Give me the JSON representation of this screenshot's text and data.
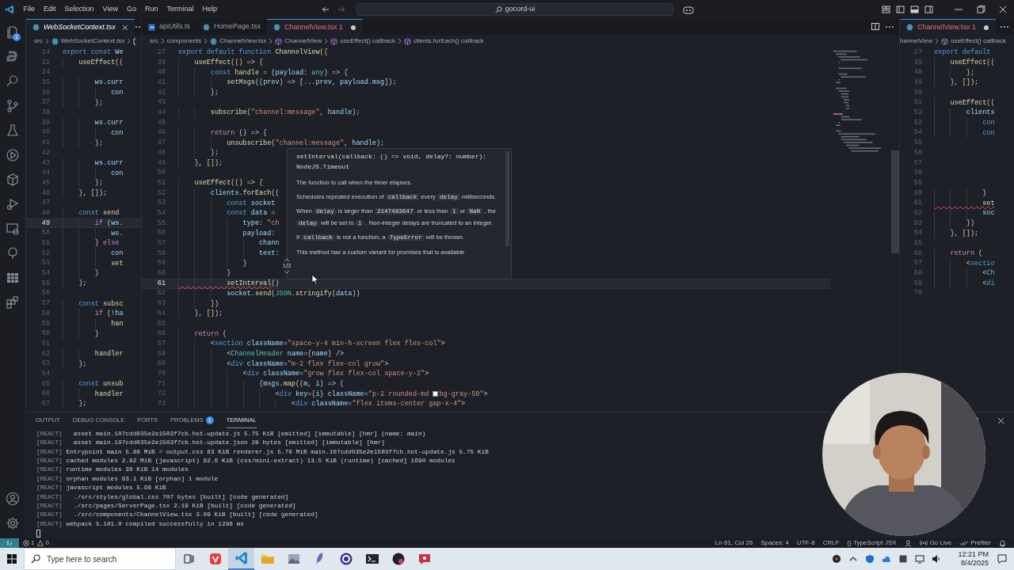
{
  "title_bar": {
    "menus": [
      "File",
      "Edit",
      "Selection",
      "View",
      "Go",
      "Run",
      "Terminal",
      "Help"
    ],
    "search": "gocord-ui"
  },
  "activity_bar": {
    "explorer_badge": "1"
  },
  "editor_groups": [
    {
      "tabs": [
        {
          "label": "WebSocketContext.tsx",
          "kind": "react",
          "selected": true,
          "preview": true,
          "dirty": false,
          "error": false
        }
      ],
      "breadcrumbs": [
        {
          "label": "src",
          "kind": "plain"
        },
        {
          "label": "WebSocketContext.tsx",
          "kind": "react"
        },
        {
          "kind": "cut"
        }
      ],
      "lines": [
        {
          "n": "14",
          "current": false,
          "t": [
            {
              "kind": "kw",
              "text": "export const "
            },
            {
              "kind": "var",
              "text": "We"
            }
          ]
        },
        {
          "n": "22",
          "current": false,
          "t": [
            {
              "kind": "fn",
              "text": "    useEffect"
            },
            {
              "kind": "br",
              "text": "(("
            }
          ]
        },
        {
          "n": "34",
          "current": false
        },
        {
          "n": "35",
          "current": false,
          "t": [
            {
              "kind": "var",
              "text": "        ws"
            },
            {
              "kind": "p",
              "text": "."
            },
            {
              "kind": "var",
              "text": "curr"
            }
          ]
        },
        {
          "n": "36",
          "current": false,
          "t": [
            {
              "kind": "var",
              "text": "            con"
            }
          ]
        },
        {
          "n": "37",
          "current": false,
          "t": [
            {
              "kind": "p",
              "text": "        };"
            }
          ]
        },
        {
          "n": "38",
          "current": false
        },
        {
          "n": "39",
          "current": false,
          "t": [
            {
              "kind": "var",
              "text": "        ws"
            },
            {
              "kind": "p",
              "text": "."
            },
            {
              "kind": "var",
              "text": "curr"
            }
          ]
        },
        {
          "n": "40",
          "current": false,
          "t": [
            {
              "kind": "var",
              "text": "            con"
            }
          ]
        },
        {
          "n": "41",
          "current": false,
          "t": [
            {
              "kind": "p",
              "text": "        };"
            }
          ]
        },
        {
          "n": "42",
          "current": false
        },
        {
          "n": "43",
          "current": false,
          "t": [
            {
              "kind": "var",
              "text": "        ws"
            },
            {
              "kind": "p",
              "text": "."
            },
            {
              "kind": "var",
              "text": "curr"
            }
          ]
        },
        {
          "n": "44",
          "current": false,
          "t": [
            {
              "kind": "var",
              "text": "            con"
            }
          ]
        },
        {
          "n": "45",
          "current": false,
          "t": [
            {
              "kind": "p",
              "text": "        };"
            }
          ]
        },
        {
          "n": "46",
          "current": false,
          "t": [
            {
              "kind": "p",
              "text": "    }, "
            },
            {
              "kind": "br",
              "text": "[]"
            },
            {
              "kind": "p",
              "text": ");"
            }
          ]
        },
        {
          "n": "47",
          "current": false
        },
        {
          "n": "48",
          "current": false,
          "t": [
            {
              "kind": "kw",
              "text": "    const "
            },
            {
              "kind": "fn",
              "text": "send"
            }
          ]
        },
        {
          "n": "49",
          "current": true,
          "t": [
            {
              "kind": "ctrl",
              "text": "        if "
            },
            {
              "kind": "p",
              "text": "("
            },
            {
              "kind": "var",
              "text": "ws"
            },
            {
              "kind": "p",
              "text": "."
            }
          ]
        },
        {
          "n": "50",
          "current": false,
          "t": [
            {
              "kind": "var",
              "text": "            ws"
            },
            {
              "kind": "p",
              "text": "."
            }
          ]
        },
        {
          "n": "51",
          "current": false,
          "t": [
            {
              "kind": "p",
              "text": "        } "
            },
            {
              "kind": "ctrl",
              "text": "else"
            }
          ]
        },
        {
          "n": "52",
          "current": false,
          "t": [
            {
              "kind": "var",
              "text": "            con"
            }
          ]
        },
        {
          "n": "53",
          "current": false,
          "t": [
            {
              "kind": "fn",
              "text": "            set"
            }
          ]
        },
        {
          "n": "54",
          "current": false,
          "t": [
            {
              "kind": "p",
              "text": "        }"
            }
          ]
        },
        {
          "n": "55",
          "current": false,
          "t": [
            {
              "kind": "p",
              "text": "    };"
            }
          ]
        },
        {
          "n": "56",
          "current": false
        },
        {
          "n": "57",
          "current": false,
          "t": [
            {
              "kind": "kw",
              "text": "    const "
            },
            {
              "kind": "fn",
              "text": "subsc"
            }
          ]
        },
        {
          "n": "58",
          "current": false,
          "t": [
            {
              "kind": "ctrl",
              "text": "        if "
            },
            {
              "kind": "p",
              "text": "(!"
            },
            {
              "kind": "var",
              "text": "ha"
            }
          ]
        },
        {
          "n": "59",
          "current": false,
          "t": [
            {
              "kind": "fn",
              "text": "            han"
            }
          ]
        },
        {
          "n": "60",
          "current": false,
          "t": [
            {
              "kind": "p",
              "text": "        }"
            }
          ]
        },
        {
          "n": "61",
          "current": false
        },
        {
          "n": "62",
          "current": false,
          "t": [
            {
              "kind": "fn",
              "text": "        handler"
            }
          ]
        },
        {
          "n": "63",
          "current": false,
          "t": [
            {
              "kind": "p",
              "text": "    };"
            }
          ]
        },
        {
          "n": "64",
          "current": false
        },
        {
          "n": "65",
          "current": false,
          "t": [
            {
              "kind": "kw",
              "text": "    const "
            },
            {
              "kind": "fn",
              "text": "unsub"
            }
          ]
        },
        {
          "n": "66",
          "current": false,
          "t": [
            {
              "kind": "fn",
              "text": "        handler"
            }
          ]
        },
        {
          "n": "67",
          "current": false,
          "t": [
            {
              "kind": "p",
              "text": "    };"
            }
          ]
        }
      ]
    },
    {
      "tabs": [
        {
          "label": "apiUtils.ts",
          "kind": "ts",
          "selected": false,
          "preview": false,
          "dirty": false,
          "error": false
        },
        {
          "label": "HomePage.tsx",
          "kind": "react",
          "selected": false,
          "preview": false,
          "dirty": false,
          "error": false
        },
        {
          "label": "ChannelView.tsx",
          "kind": "react",
          "selected": true,
          "preview": false,
          "dirty": true,
          "error": true,
          "problems": "1"
        }
      ],
      "breadcrumbs": [
        {
          "label": "src",
          "kind": "plain"
        },
        {
          "label": "components",
          "kind": "plain"
        },
        {
          "label": "ChannelView.tsx",
          "kind": "react"
        },
        {
          "label": "ChannelView",
          "kind": "symbol"
        },
        {
          "label": "useEffect() callback",
          "kind": "symbol"
        },
        {
          "label": "clients.forEach() callback",
          "kind": "symbol"
        }
      ],
      "lines": [
        {
          "n": "27",
          "current": false,
          "t": [
            {
              "kind": "kw",
              "text": "export default function "
            },
            {
              "kind": "fn",
              "text": "ChannelView"
            },
            {
              "kind": "br",
              "text": "({"
            }
          ]
        },
        {
          "n": "39",
          "current": false,
          "t": [
            {
              "kind": "fn",
              "text": "    useEffect"
            },
            {
              "kind": "br",
              "text": "(()"
            },
            {
              "kind": "p",
              "text": " => "
            },
            {
              "kind": "br",
              "text": "{"
            }
          ]
        },
        {
          "n": "40",
          "current": false,
          "t": [
            {
              "kind": "kw",
              "text": "        const "
            },
            {
              "kind": "fn",
              "text": "handle"
            },
            {
              "kind": "p",
              "text": " = ("
            },
            {
              "kind": "var",
              "text": "payload"
            },
            {
              "kind": "p",
              "text": ": "
            },
            {
              "kind": "type",
              "text": "any"
            },
            {
              "kind": "p",
              "text": ") => {"
            }
          ]
        },
        {
          "n": "41",
          "current": false,
          "t": [
            {
              "kind": "fn",
              "text": "            setMsgs"
            },
            {
              "kind": "p",
              "text": "(("
            },
            {
              "kind": "var",
              "text": "prev"
            },
            {
              "kind": "p",
              "text": ") => [..."
            },
            {
              "kind": "var",
              "text": "prev"
            },
            {
              "kind": "p",
              "text": ", "
            },
            {
              "kind": "var",
              "text": "payload"
            },
            {
              "kind": "p",
              "text": "."
            },
            {
              "kind": "var",
              "text": "msg"
            },
            {
              "kind": "p",
              "text": "]);"
            }
          ]
        },
        {
          "n": "42",
          "current": false,
          "t": [
            {
              "kind": "p",
              "text": "        };"
            }
          ]
        },
        {
          "n": "43",
          "current": false
        },
        {
          "n": "44",
          "current": false,
          "t": [
            {
              "kind": "fn",
              "text": "        subscribe"
            },
            {
              "kind": "p",
              "text": "("
            },
            {
              "kind": "str",
              "text": "\"channel:message\""
            },
            {
              "kind": "p",
              "text": ", "
            },
            {
              "kind": "var",
              "text": "handle"
            },
            {
              "kind": "p",
              "text": ");"
            }
          ]
        },
        {
          "n": "45",
          "current": false
        },
        {
          "n": "46",
          "current": false,
          "t": [
            {
              "kind": "ctrl",
              "text": "        return "
            },
            {
              "kind": "p",
              "text": "() => {"
            }
          ]
        },
        {
          "n": "47",
          "current": false,
          "t": [
            {
              "kind": "fn",
              "text": "            unsubscribe"
            },
            {
              "kind": "p",
              "text": "("
            },
            {
              "kind": "str",
              "text": "\"channel:message\""
            },
            {
              "kind": "p",
              "text": ", "
            },
            {
              "kind": "var",
              "text": "handle"
            },
            {
              "kind": "p",
              "text": ");"
            }
          ]
        },
        {
          "n": "48",
          "current": false,
          "t": [
            {
              "kind": "p",
              "text": "        };"
            }
          ]
        },
        {
          "n": "49",
          "current": false,
          "t": [
            {
              "kind": "p",
              "text": "    }, "
            },
            {
              "kind": "br",
              "text": "[]"
            },
            {
              "kind": "p",
              "text": ");"
            }
          ]
        },
        {
          "n": "50",
          "current": false
        },
        {
          "n": "51",
          "current": false,
          "t": [
            {
              "kind": "fn",
              "text": "    useEffect"
            },
            {
              "kind": "br",
              "text": "(()"
            },
            {
              "kind": "p",
              "text": " => "
            },
            {
              "kind": "br",
              "text": "{"
            }
          ]
        },
        {
          "n": "52",
          "current": false,
          "t": [
            {
              "kind": "var",
              "text": "        clients"
            },
            {
              "kind": "p",
              "text": "."
            },
            {
              "kind": "fn",
              "text": "forEach"
            },
            {
              "kind": "p",
              "text": "(("
            }
          ]
        },
        {
          "n": "53",
          "current": false,
          "t": [
            {
              "kind": "kw",
              "text": "            const "
            },
            {
              "kind": "var",
              "text": "socket"
            }
          ]
        },
        {
          "n": "54",
          "current": false,
          "t": [
            {
              "kind": "kw",
              "text": "            const "
            },
            {
              "kind": "var",
              "text": "data"
            },
            {
              "kind": "p",
              "text": " ="
            }
          ]
        },
        {
          "n": "55",
          "current": false,
          "t": [
            {
              "kind": "var",
              "text": "                type"
            },
            {
              "kind": "p",
              "text": ": "
            },
            {
              "kind": "str",
              "text": "\"ch"
            }
          ]
        },
        {
          "n": "56",
          "current": false,
          "t": [
            {
              "kind": "var",
              "text": "                payload"
            },
            {
              "kind": "p",
              "text": ":"
            }
          ]
        },
        {
          "n": "57",
          "current": false,
          "t": [
            {
              "kind": "var",
              "text": "                    chann"
            }
          ]
        },
        {
          "n": "58",
          "current": false,
          "t": [
            {
              "kind": "var",
              "text": "                    text"
            },
            {
              "kind": "p",
              "text": ":"
            }
          ]
        },
        {
          "n": "59",
          "current": false,
          "t": [
            {
              "kind": "p",
              "text": "                }"
            }
          ]
        },
        {
          "n": "60",
          "current": false,
          "t": [
            {
              "kind": "p",
              "text": "            }"
            }
          ]
        },
        {
          "n": "61",
          "current": true,
          "t": [
            {
              "kind": "fnerr",
              "text": "            setInterval"
            },
            {
              "kind": "p",
              "text": "()"
            }
          ]
        },
        {
          "n": "62",
          "current": false,
          "t": [
            {
              "kind": "var",
              "text": "            socket"
            },
            {
              "kind": "p",
              "text": "."
            },
            {
              "kind": "fn",
              "text": "send"
            },
            {
              "kind": "p",
              "text": "("
            },
            {
              "kind": "type",
              "text": "JSON"
            },
            {
              "kind": "p",
              "text": "."
            },
            {
              "kind": "fn",
              "text": "stringify"
            },
            {
              "kind": "p",
              "text": "("
            },
            {
              "kind": "var",
              "text": "data"
            },
            {
              "kind": "p",
              "text": "))"
            }
          ]
        },
        {
          "n": "63",
          "current": false,
          "t": [
            {
              "kind": "p",
              "text": "        })"
            }
          ]
        },
        {
          "n": "64",
          "current": false,
          "t": [
            {
              "kind": "p",
              "text": "    }, "
            },
            {
              "kind": "br",
              "text": "[]"
            },
            {
              "kind": "p",
              "text": ");"
            }
          ]
        },
        {
          "n": "65",
          "current": false
        },
        {
          "n": "66",
          "current": false,
          "t": [
            {
              "kind": "ctrl",
              "text": "    return "
            },
            {
              "kind": "br",
              "text": "("
            }
          ]
        },
        {
          "n": "67",
          "current": false,
          "t": [
            {
              "kind": "p",
              "text": "        <"
            },
            {
              "kind": "tag",
              "text": "section "
            },
            {
              "kind": "attr",
              "text": "className"
            },
            {
              "kind": "p",
              "text": "="
            },
            {
              "kind": "str",
              "text": "\"space-y-4 min-h-screen flex flex-col\""
            },
            {
              "kind": "p",
              "text": ">"
            }
          ]
        },
        {
          "n": "68",
          "current": false,
          "t": [
            {
              "kind": "p",
              "text": "            <"
            },
            {
              "kind": "comp",
              "text": "ChannelHeader "
            },
            {
              "kind": "attr",
              "text": "name"
            },
            {
              "kind": "p",
              "text": "={"
            },
            {
              "kind": "var",
              "text": "name"
            },
            {
              "kind": "p",
              "text": "} />"
            }
          ]
        },
        {
          "n": "69",
          "current": false,
          "t": [
            {
              "kind": "p",
              "text": "            <"
            },
            {
              "kind": "tag",
              "text": "div "
            },
            {
              "kind": "attr",
              "text": "className"
            },
            {
              "kind": "p",
              "text": "="
            },
            {
              "kind": "str",
              "text": "\"m-2 flex flex-col grow\""
            },
            {
              "kind": "p",
              "text": ">"
            }
          ]
        },
        {
          "n": "70",
          "current": false,
          "t": [
            {
              "kind": "p",
              "text": "                <"
            },
            {
              "kind": "tag",
              "text": "div "
            },
            {
              "kind": "attr",
              "text": "className"
            },
            {
              "kind": "p",
              "text": "="
            },
            {
              "kind": "str",
              "text": "\"grow flex flex-col space-y-2\""
            },
            {
              "kind": "p",
              "text": ">"
            }
          ]
        },
        {
          "n": "71",
          "current": false,
          "t": [
            {
              "kind": "p",
              "text": "                    {"
            },
            {
              "kind": "var",
              "text": "msgs"
            },
            {
              "kind": "p",
              "text": "."
            },
            {
              "kind": "fn",
              "text": "map"
            },
            {
              "kind": "p",
              "text": "(("
            },
            {
              "kind": "var",
              "text": "m"
            },
            {
              "kind": "p",
              "text": ", "
            },
            {
              "kind": "var",
              "text": "i"
            },
            {
              "kind": "p",
              "text": ") => ("
            }
          ]
        },
        {
          "n": "72",
          "current": false,
          "t": [
            {
              "kind": "p",
              "text": "                        <"
            },
            {
              "kind": "tag",
              "text": "div "
            },
            {
              "kind": "attr",
              "text": "key"
            },
            {
              "kind": "p",
              "text": "={"
            },
            {
              "kind": "var",
              "text": "i"
            },
            {
              "kind": "p",
              "text": "} "
            },
            {
              "kind": "attr",
              "text": "className"
            },
            {
              "kind": "p",
              "text": "="
            },
            {
              "kind": "str",
              "text": "\"p-2 rounded-md "
            },
            {
              "kind": "swatch"
            },
            {
              "kind": "str",
              "text": "bg-gray-50\""
            },
            {
              "kind": "p",
              "text": ">"
            }
          ]
        },
        {
          "n": "73",
          "current": false,
          "t": [
            {
              "kind": "p",
              "text": "                            <"
            },
            {
              "kind": "tag",
              "text": "div "
            },
            {
              "kind": "attr",
              "text": "className"
            },
            {
              "kind": "p",
              "text": "="
            },
            {
              "kind": "str",
              "text": "\"flex items-center gap-x-4\""
            },
            {
              "kind": "p",
              "text": ">"
            }
          ]
        }
      ]
    },
    {
      "tabs": [
        {
          "label": "ChannelView.tsx",
          "kind": "react",
          "selected": true,
          "preview": false,
          "dirty": true,
          "error": true,
          "problems": "1"
        }
      ],
      "breadcrumbs": [
        {
          "label": "hannelView",
          "kind": "plain"
        },
        {
          "label": "useEffect() callback",
          "kind": "symbol"
        }
      ],
      "lines": [
        {
          "n": "27",
          "current": false,
          "t": [
            {
              "kind": "kw",
              "text": "export default"
            }
          ]
        },
        {
          "n": "39",
          "current": false,
          "t": [
            {
              "kind": "fn",
              "text": "    useEffect"
            },
            {
              "kind": "br",
              "text": "(("
            }
          ]
        },
        {
          "n": "48",
          "current": false,
          "t": [
            {
              "kind": "p",
              "text": "        };"
            }
          ]
        },
        {
          "n": "49",
          "current": false,
          "t": [
            {
              "kind": "p",
              "text": "    }, "
            },
            {
              "kind": "br",
              "text": "[]"
            },
            {
              "kind": "p",
              "text": ");"
            }
          ]
        },
        {
          "n": "50",
          "current": false
        },
        {
          "n": "51",
          "current": false,
          "t": [
            {
              "kind": "fn",
              "text": "    useEffect"
            },
            {
              "kind": "br",
              "text": "(("
            }
          ]
        },
        {
          "n": "52",
          "current": false,
          "t": [
            {
              "kind": "var",
              "text": "        clients"
            }
          ]
        },
        {
          "n": "53",
          "current": false,
          "t": [
            {
              "kind": "kw",
              "text": "            con"
            }
          ]
        },
        {
          "n": "54",
          "current": false,
          "t": [
            {
              "kind": "kw",
              "text": "            con"
            }
          ]
        },
        {
          "n": "55",
          "current": false
        },
        {
          "n": "56",
          "current": false
        },
        {
          "n": "57",
          "current": false
        },
        {
          "n": "58",
          "current": false
        },
        {
          "n": "59",
          "current": false
        },
        {
          "n": "60",
          "current": false,
          "t": [
            {
              "kind": "p",
              "text": "            }"
            }
          ]
        },
        {
          "n": "61",
          "current": false,
          "t": [
            {
              "kind": "fnerr",
              "text": "            set"
            }
          ]
        },
        {
          "n": "62",
          "current": false,
          "t": [
            {
              "kind": "var",
              "text": "            soc"
            }
          ]
        },
        {
          "n": "63",
          "current": false,
          "t": [
            {
              "kind": "p",
              "text": "        })"
            }
          ]
        },
        {
          "n": "64",
          "current": false,
          "t": [
            {
              "kind": "p",
              "text": "    }, "
            },
            {
              "kind": "br",
              "text": "[]"
            },
            {
              "kind": "p",
              "text": ");"
            }
          ]
        },
        {
          "n": "65",
          "current": false
        },
        {
          "n": "66",
          "current": false,
          "t": [
            {
              "kind": "ctrl",
              "text": "    return "
            },
            {
              "kind": "br",
              "text": "("
            }
          ]
        },
        {
          "n": "67",
          "current": false,
          "t": [
            {
              "kind": "p",
              "text": "        <"
            },
            {
              "kind": "tag",
              "text": "sectio"
            }
          ]
        },
        {
          "n": "68",
          "current": false,
          "t": [
            {
              "kind": "p",
              "text": "            <"
            },
            {
              "kind": "comp",
              "text": "Ch"
            }
          ]
        },
        {
          "n": "69",
          "current": false,
          "t": [
            {
              "kind": "p",
              "text": "            <"
            },
            {
              "kind": "tag",
              "text": "di"
            }
          ]
        },
        {
          "n": "70",
          "current": false
        }
      ]
    }
  ],
  "hover": {
    "signature": [
      "setInterval(callback: () => void, delay?: number):",
      "NodeJS.Timeout"
    ],
    "paragraphs": [
      [
        {
          "kind": "text",
          "text": "The function to call when the timer elapses."
        }
      ],
      [
        {
          "kind": "text",
          "text": "Schedules repeated execution of "
        },
        {
          "kind": "code",
          "text": "callback"
        },
        {
          "kind": "text",
          "text": " every "
        },
        {
          "kind": "code",
          "text": "delay"
        },
        {
          "kind": "text",
          "text": " milliseconds."
        }
      ],
      [
        {
          "kind": "text",
          "text": "When "
        },
        {
          "kind": "code",
          "text": "delay"
        },
        {
          "kind": "text",
          "text": " is larger than "
        },
        {
          "kind": "code",
          "text": "2147483647"
        },
        {
          "kind": "text",
          "text": " or less than "
        },
        {
          "kind": "code",
          "text": "1"
        },
        {
          "kind": "text",
          "text": " or "
        },
        {
          "kind": "code",
          "text": "NaN"
        },
        {
          "kind": "text",
          "text": " , the "
        },
        {
          "kind": "code",
          "text": "delay"
        },
        {
          "kind": "text",
          "text": " will be set to "
        },
        {
          "kind": "code",
          "text": "1"
        },
        {
          "kind": "text",
          "text": " . Non-integer delays are truncated to an integer."
        }
      ],
      [
        {
          "kind": "text",
          "text": "If "
        },
        {
          "kind": "code",
          "text": "callback"
        },
        {
          "kind": "text",
          "text": " is not a function, a "
        },
        {
          "kind": "code",
          "text": "TypeError"
        },
        {
          "kind": "text",
          "text": " will be thrown."
        }
      ],
      [
        {
          "kind": "text",
          "text": "This method has a custom variant for promises that is available"
        }
      ]
    ],
    "overload": "1/3"
  },
  "panel": {
    "tabs": [
      {
        "label": "OUTPUT",
        "selected": false
      },
      {
        "label": "DEBUG CONSOLE",
        "selected": false
      },
      {
        "label": "PORTS",
        "selected": false
      },
      {
        "label": "PROBLEMS",
        "selected": false,
        "badge": "1"
      },
      {
        "label": "TERMINAL",
        "selected": true
      }
    ],
    "lines": [
      {
        "prefix": "[REACT]",
        "text": "  asset main.107cdd035e2e1503f7cb.hot-update.js 5.75 KiB [emitted] [immutable] [hmr] (name: main)"
      },
      {
        "prefix": "[REACT]",
        "text": "  asset main.107cdd035e2e1503f7cb.hot-update.json 28 bytes [emitted] [immutable] [hmr]"
      },
      {
        "prefix": "[REACT]",
        "text": "Entrypoint main 5.88 MiB = output.css 83 KiB renderer.js 5.79 MiB main.107cdd035e2e1503f7cb.hot-update.js 5.75 KiB"
      },
      {
        "prefix": "[REACT]",
        "text": "cached modules 2.92 MiB (javascript) 82.6 KiB (css/mini-extract) 13.5 KiB (runtime) [cached] 1690 modules"
      },
      {
        "prefix": "[REACT]",
        "text": "runtime modules 30 KiB 14 modules"
      },
      {
        "prefix": "[REACT]",
        "text": "orphan modules 83.1 KiB [orphan] 1 module"
      },
      {
        "prefix": "[REACT]",
        "text": "javascript modules 5.98 KiB"
      },
      {
        "prefix": "[REACT]",
        "text": "  ./src/styles/global.css 707 bytes [built] [code generated]"
      },
      {
        "prefix": "[REACT]",
        "text": "  ./src/pages/ServerPage.tsx 2.19 KiB [built] [code generated]"
      },
      {
        "prefix": "[REACT]",
        "text": "  ./src/components/ChannelView.tsx 3.09 KiB [built] [code generated]"
      },
      {
        "prefix": "[REACT]",
        "text": "webpack 5.101.0 compiled successfully in 1286 ms"
      }
    ]
  },
  "status_bar": {
    "errors": "1",
    "warnings": "0",
    "items": [
      "Ln 61, Col 26",
      "Spaces: 4",
      "UTF-8",
      "CRLF",
      "{} TypeScript JSX"
    ],
    "go_live": "Go Live",
    "prettier": "Prettier"
  },
  "taskbar": {
    "search_placeholder": "Type here to search",
    "apps": [
      {
        "active": false
      },
      {
        "active": true
      },
      {
        "active": false
      },
      {
        "active": false
      },
      {
        "active": false
      },
      {
        "active": false
      },
      {
        "active": false
      },
      {
        "active": false
      },
      {
        "active": false
      }
    ],
    "time": "12:21 PM",
    "date": "8/4/2025"
  }
}
